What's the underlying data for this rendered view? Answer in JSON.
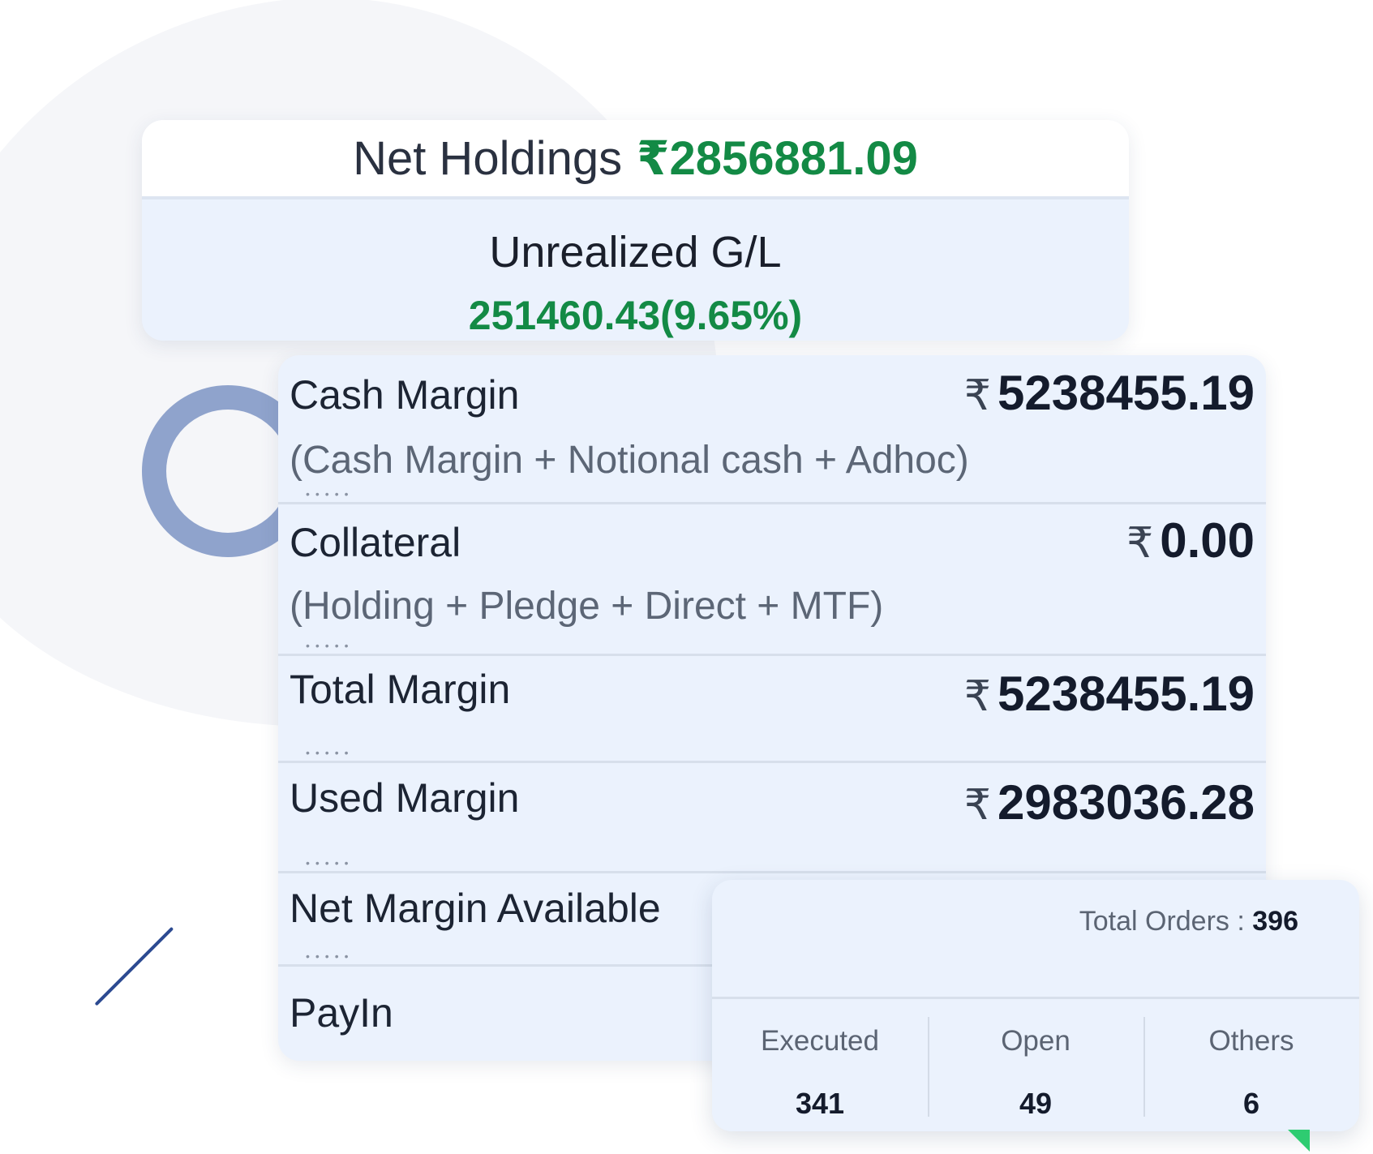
{
  "holdings": {
    "net_label": "Net Holdings",
    "net_value": "₹2856881.09",
    "gl_title": "Unrealized G/L",
    "gl_value": "251460.43(9.65%)"
  },
  "margin": {
    "currency": "₹",
    "rows": [
      {
        "label": "Cash Margin",
        "sub": "(Cash Margin + Notional cash + Adhoc)",
        "value": "5238455.19"
      },
      {
        "label": "Collateral",
        "sub": "(Holding + Pledge + Direct + MTF)",
        "value": "0.00"
      },
      {
        "label": "Total Margin",
        "value": "5238455.19"
      },
      {
        "label": "Used Margin",
        "value": "2983036.28"
      },
      {
        "label": "Net Margin Available"
      },
      {
        "label": "PayIn"
      }
    ]
  },
  "orders": {
    "total_label": "Total Orders :",
    "total_value": "396",
    "columns": [
      {
        "label": "Executed",
        "value": "341"
      },
      {
        "label": "Open",
        "value": "49"
      },
      {
        "label": "Others",
        "value": "6"
      }
    ]
  },
  "colors": {
    "positive": "#138a45",
    "card_bg": "#ebf2fd",
    "ring": "#8fa3cc",
    "accent_line": "#2c4a91",
    "accent_triangle": "#2ecc71"
  }
}
